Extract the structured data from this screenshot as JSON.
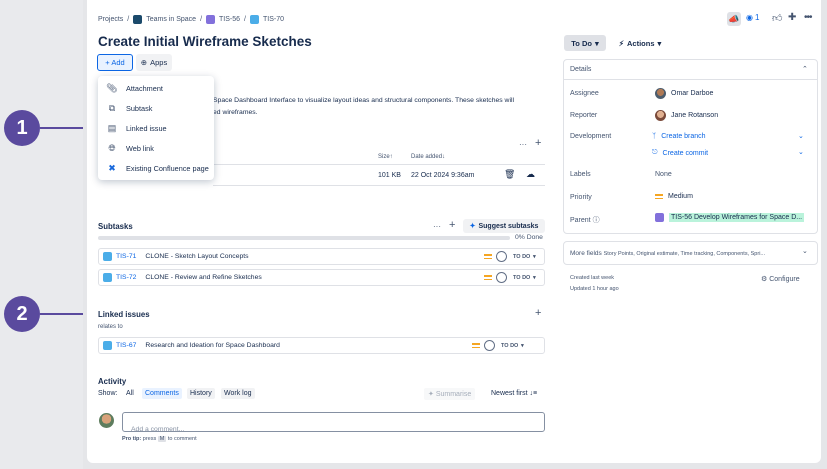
{
  "callouts": [
    "1",
    "2"
  ],
  "breadcrumb": {
    "projects": "Projects",
    "sep": "/",
    "space": "Teams in Space",
    "parent": "TIS-56",
    "current": "TIS-70"
  },
  "header": {
    "watch_count": "1"
  },
  "title": "Create Initial Wireframe Sketches",
  "toolbar": {
    "add": "+ Add",
    "apps": "Apps"
  },
  "add_menu": [
    "Attachment",
    "Subtask",
    "Linked issue",
    "Web link",
    "Existing Confluence page"
  ],
  "description": {
    "line1": "Space Dashboard Interface to visualize layout ideas and structural components. These sketches will",
    "line2": "ed wireframes."
  },
  "attachments": {
    "col_size": "Size",
    "col_date": "Date added",
    "size": "101 KB",
    "date": "22 Oct 2024 9:36am",
    "more": "···"
  },
  "subtasks": {
    "heading": "Subtasks",
    "more": "···",
    "suggest": "Suggest subtasks",
    "progress": "0% Done",
    "progress_value": 0,
    "items": [
      {
        "key": "TIS-71",
        "summary": "CLONE - Sketch Layout Concepts",
        "status": "TO DO"
      },
      {
        "key": "TIS-72",
        "summary": "CLONE - Review and Refine Sketches",
        "status": "TO DO"
      }
    ]
  },
  "linked": {
    "heading": "Linked issues",
    "relation": "relates to",
    "items": [
      {
        "key": "TIS-67",
        "summary": "Research and Ideation for Space Dashboard",
        "status": "TO DO"
      }
    ]
  },
  "activity": {
    "heading": "Activity",
    "show": "Show:",
    "filters": [
      "All",
      "Comments",
      "History",
      "Work log"
    ],
    "summarise": "Summarise",
    "sort": "Newest first",
    "comment_placeholder": "Add a comment...",
    "pro_tip_a": "Pro tip:",
    "pro_tip_b": "press",
    "pro_tip_key": "M",
    "pro_tip_c": "to comment"
  },
  "side": {
    "status": "To Do",
    "actions": "Actions",
    "details": "Details",
    "fields": {
      "assignee_label": "Assignee",
      "assignee": "Omar Darboe",
      "reporter_label": "Reporter",
      "reporter": "Jane Rotanson",
      "development_label": "Development",
      "branch": "Create branch",
      "commit": "Create commit",
      "labels_label": "Labels",
      "labels": "None",
      "priority_label": "Priority",
      "priority": "Medium",
      "parent_label": "Parent",
      "parent": "TIS-56 Develop Wireframes for Space D..."
    },
    "more_fields": "More fields",
    "more_fields_list": "Story Points, Original estimate, Time tracking, Components, Spri...",
    "created": "Created last week",
    "updated": "Updated 1 hour ago",
    "configure": "Configure"
  },
  "colors": {
    "accent": "#0c66e4",
    "callout": "#5a4a9e",
    "subtask": "#4bade8",
    "parent": "#8270db",
    "parent_bg": "#baf3db"
  }
}
